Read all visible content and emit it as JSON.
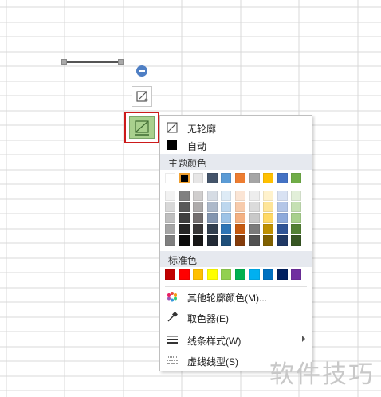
{
  "menu": {
    "no_outline": "无轮廓",
    "auto": "自动",
    "theme_colors_header": "主题颜色",
    "standard_colors_header": "标准色",
    "more_outline_colors": "其他轮廓颜色(M)...",
    "eyedropper": "取色器(E)",
    "line_style": "线条样式(W)",
    "dash_type": "虚线线型(S)"
  },
  "theme_colors": {
    "top_row": [
      "#ffffff",
      "#000000",
      "#e7e6e6",
      "#44546a",
      "#5b9bd5",
      "#ed7d31",
      "#a5a5a5",
      "#ffc000",
      "#4472c4",
      "#70ad47"
    ],
    "shade_rows": [
      [
        "#f2f2f2",
        "#808080",
        "#d0cece",
        "#d6dce4",
        "#deebf6",
        "#fbe5d5",
        "#ededed",
        "#fff2cc",
        "#d9e2f3",
        "#e2efd9"
      ],
      [
        "#d8d8d8",
        "#595959",
        "#aeabab",
        "#adb9ca",
        "#bdd7ee",
        "#f7cbac",
        "#dbdbdb",
        "#fee599",
        "#b4c6e7",
        "#c5e0b3"
      ],
      [
        "#bfbfbf",
        "#3f3f3f",
        "#757070",
        "#8496b0",
        "#9dc3e6",
        "#f4b183",
        "#c9c9c9",
        "#ffd965",
        "#8eaadb",
        "#a8d08d"
      ],
      [
        "#a5a5a5",
        "#262626",
        "#3a3838",
        "#323f4f",
        "#2e75b5",
        "#c55a11",
        "#7b7b7b",
        "#bf9000",
        "#2f5496",
        "#538135"
      ],
      [
        "#7f7f7f",
        "#0c0c0c",
        "#171616",
        "#222a35",
        "#1e4e79",
        "#843c0b",
        "#525252",
        "#7f6000",
        "#1f3864",
        "#375623"
      ]
    ],
    "selected": "#000000"
  },
  "standard_colors": [
    "#c00000",
    "#ff0000",
    "#ffc000",
    "#ffff00",
    "#92d050",
    "#00b050",
    "#00b0f0",
    "#0070c0",
    "#002060",
    "#7030a0"
  ],
  "icons": {
    "no_outline": "no-outline-icon",
    "auto": "auto-color-icon",
    "more_colors": "color-wheel-icon",
    "eyedropper": "eyedropper-icon",
    "line_style": "line-style-icon",
    "dash_type": "dash-type-icon",
    "rotate": "rotate-handle-icon",
    "format_shape": "format-shape-icon",
    "outline": "shape-outline-icon"
  },
  "colors": {
    "highlight_border": "#cc1a1a",
    "outline_button_fill": "#a9d08e",
    "section_header_bg": "#e6e9ef",
    "grid_line": "#d9d9d9"
  },
  "watermark": "软件技巧"
}
